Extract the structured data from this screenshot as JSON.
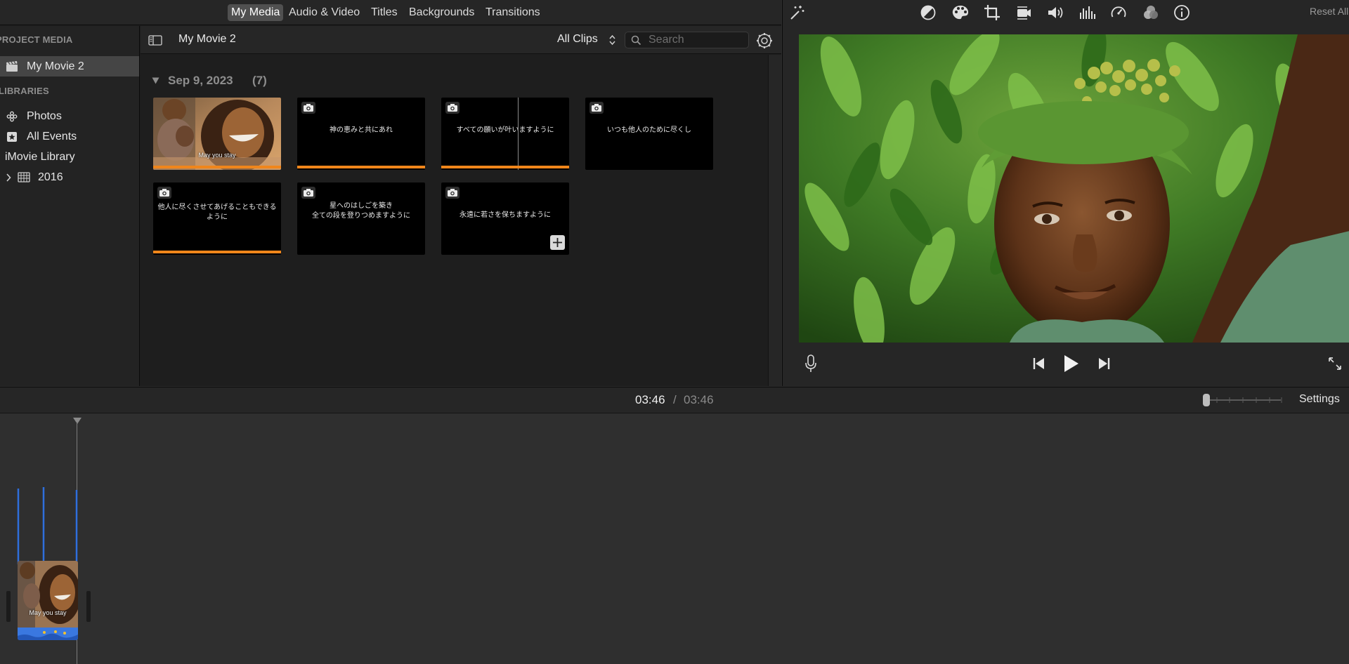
{
  "media_tabs": [
    {
      "label": "My Media",
      "active": true
    },
    {
      "label": "Audio & Video",
      "active": false
    },
    {
      "label": "Titles",
      "active": false
    },
    {
      "label": "Backgrounds",
      "active": false
    },
    {
      "label": "Transitions",
      "active": false
    }
  ],
  "sidebar": {
    "project_media_heading": "PROJECT MEDIA",
    "project_item": "My Movie 2",
    "libraries_heading": "LIBRARIES",
    "photos": "Photos",
    "all_events": "All Events",
    "library": "iMovie Library",
    "year": "2016"
  },
  "content": {
    "project_title": "My Movie 2",
    "filter_label": "All Clips",
    "search_placeholder": "Search",
    "date_group": "Sep 9, 2023",
    "clip_count": "(7)",
    "clips": [
      {
        "text": "May you stay",
        "type": "photo",
        "used": true
      },
      {
        "text": "神の恵みと共にあれ",
        "type": "title",
        "used": true
      },
      {
        "text": "すべての願いが叶いますように",
        "type": "title",
        "used": true
      },
      {
        "text": "いつも他人のために尽くし",
        "type": "title",
        "used": false
      },
      {
        "text": "他人に尽くさせてあげることもできる\nように",
        "type": "title",
        "used": true
      },
      {
        "text": "星へのはしごを築き\n全ての段を登りつめますように",
        "type": "title",
        "used": false
      },
      {
        "text": "永遠に若さを保ちますように",
        "type": "title",
        "used": false
      }
    ]
  },
  "viewer": {
    "reset_label": "Reset All",
    "toolbar_icons": [
      "magic-wand-icon",
      "color-balance-icon",
      "color-palette-icon",
      "crop-icon",
      "stabilization-icon",
      "volume-icon",
      "equalizer-icon",
      "speed-icon",
      "clip-filter-icon",
      "info-icon"
    ]
  },
  "timeline": {
    "current_time": "03:46",
    "separator": "/",
    "total_time": "03:46",
    "settings_label": "Settings",
    "clip_caption": "May you stay"
  },
  "colors": {
    "accent_orange": "#f0861b",
    "timeline_blue": "#2f6fdc",
    "selection_gray": "#454545"
  }
}
